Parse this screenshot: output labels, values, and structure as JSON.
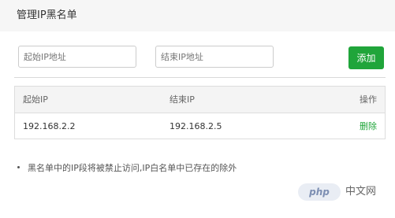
{
  "header": {
    "title": "管理IP黑名单"
  },
  "form": {
    "start_ip_placeholder": "起始IP地址",
    "start_ip_value": "",
    "end_ip_placeholder": "结束IP地址",
    "end_ip_value": "",
    "add_label": "添加"
  },
  "table": {
    "headers": [
      "起始IP",
      "结束IP",
      "操作"
    ],
    "rows": [
      {
        "start_ip": "192.168.2.2",
        "end_ip": "192.168.2.5",
        "action": "删除"
      }
    ]
  },
  "note": "黑名单中的IP段将被禁止访问,IP白名单中已存在的除外",
  "watermark": {
    "logo": "php",
    "text": "中文网"
  },
  "colors": {
    "accent": "#20a53a",
    "header_bg": "#f6f6f6",
    "table_head_bg": "#f4f4f4"
  }
}
